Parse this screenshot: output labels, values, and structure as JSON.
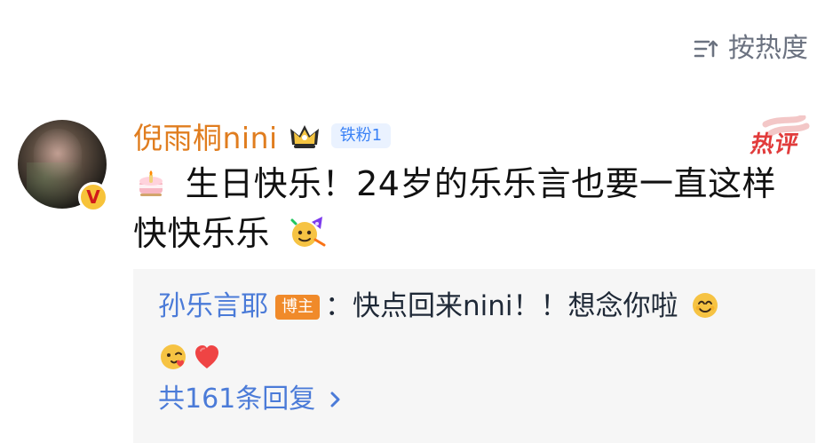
{
  "sort": {
    "label": "按热度",
    "icon": "sort-icon",
    "color": "#6b7280"
  },
  "comment": {
    "author": "倪雨桐nini",
    "fan_badge": "铁粉1",
    "hot_tag": "热评",
    "text_prefix": "生日快乐！24岁的乐乐言也要一直这样快快乐乐",
    "text_emoji_leading": "birthday-cake-emoji",
    "text_emoji_trailing": "party-face-emoji",
    "colors": {
      "username": "#e07d1f",
      "hot": "#e23b3b"
    }
  },
  "reply": {
    "author": "孙乐言耶",
    "author_badge": "博主",
    "text": "：快点回来nini！！想念你啦",
    "emojis": [
      "smiling-face-with-smiling-eyes-emoji",
      "face-blowing-kiss-emoji",
      "red-heart-emoji"
    ],
    "more": "共161条回复",
    "colors": {
      "link": "#4b7bd8",
      "badge": "#f08a2a",
      "bg": "#f6f6f6"
    }
  }
}
